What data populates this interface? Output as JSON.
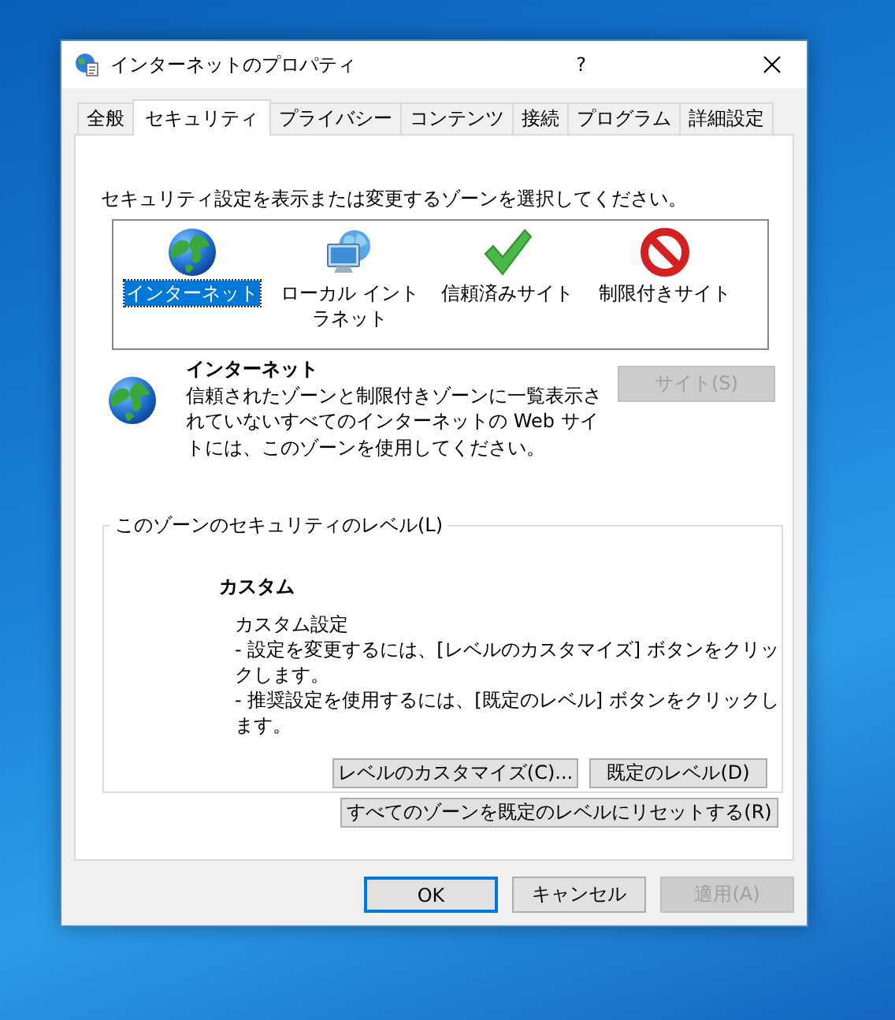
{
  "window": {
    "title": "インターネットのプロパティ",
    "help": "?"
  },
  "tabs": [
    {
      "label": "全般",
      "selected": false
    },
    {
      "label": "セキュリティ",
      "selected": true
    },
    {
      "label": "プライバシー",
      "selected": false
    },
    {
      "label": "コンテンツ",
      "selected": false
    },
    {
      "label": "接続",
      "selected": false
    },
    {
      "label": "プログラム",
      "selected": false
    },
    {
      "label": "詳細設定",
      "selected": false
    }
  ],
  "zones": {
    "instruction": "セキュリティ設定を表示または変更するゾーンを選択してください。",
    "items": [
      {
        "label": "インターネット",
        "kind": "globe",
        "selected": true
      },
      {
        "label": "ローカル イントラネット",
        "kind": "intranet",
        "selected": false
      },
      {
        "label": "信頼済みサイト",
        "kind": "check",
        "selected": false
      },
      {
        "label": "制限付きサイト",
        "kind": "blocked",
        "selected": false
      }
    ]
  },
  "zone_info": {
    "title": "インターネット",
    "description": "信頼されたゾーンと制限付きゾーンに一覧表示されていないすべてのインターネットの Web サイトには、このゾーンを使用してください。",
    "sites_button": {
      "label": "サイト(S)",
      "disabled": true
    }
  },
  "security_level": {
    "legend": "このゾーンのセキュリティのレベル(L)",
    "level_name": "カスタム",
    "details": [
      "カスタム設定",
      "- 設定を変更するには、[レベルのカスタマイズ] ボタンをクリックします。",
      "- 推奨設定を使用するには、[既定のレベル] ボタンをクリックします。"
    ],
    "buttons": [
      {
        "label": "レベルのカスタマイズ(C)...",
        "disabled": false
      },
      {
        "label": "既定のレベル(D)",
        "disabled": false
      }
    ],
    "reset_button": {
      "label": "すべてのゾーンを既定のレベルにリセットする(R)",
      "disabled": false
    }
  },
  "footer_buttons": [
    {
      "label": "OK",
      "default": true,
      "disabled": false
    },
    {
      "label": "キャンセル",
      "default": false,
      "disabled": false
    },
    {
      "label": "適用(A)",
      "default": false,
      "disabled": true
    }
  ]
}
